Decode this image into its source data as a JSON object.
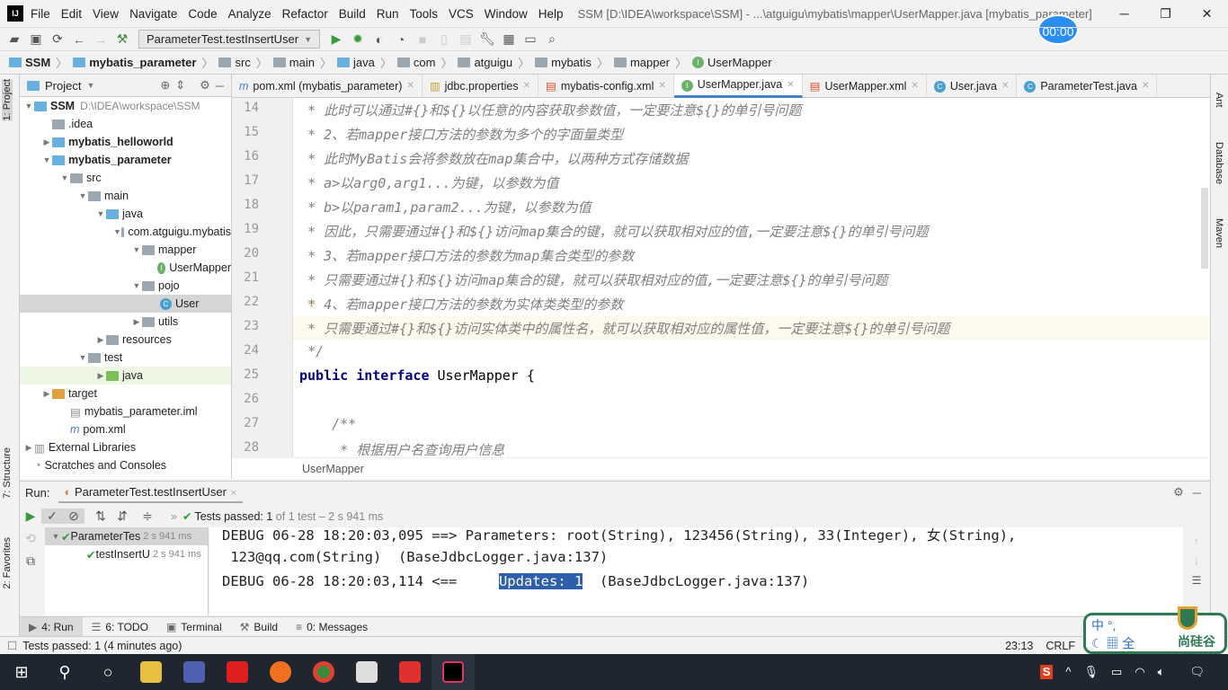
{
  "app": {
    "logo": "IJ",
    "title": "SSM [D:\\IDEA\\workspace\\SSM] - ...\\atguigu\\mybatis\\mapper\\UserMapper.java [mybatis_parameter]"
  },
  "menu": [
    "File",
    "Edit",
    "View",
    "Navigate",
    "Code",
    "Analyze",
    "Refactor",
    "Build",
    "Run",
    "Tools",
    "VCS",
    "Window",
    "Help"
  ],
  "toolbar": {
    "run_config": "ParameterTest.testInsertUser"
  },
  "breadcrumb": [
    "SSM",
    "mybatis_parameter",
    "src",
    "main",
    "java",
    "com",
    "atguigu",
    "mybatis",
    "mapper",
    "UserMapper"
  ],
  "left_stripe": {
    "project": "1: Project",
    "structure": "7: Structure",
    "favorites": "2: Favorites"
  },
  "right_stripe": {
    "ant": "Ant",
    "database": "Database",
    "maven": "Maven"
  },
  "project": {
    "header": "Project",
    "tree": [
      {
        "label": "SSM",
        "note": "D:\\IDEA\\workspace\\SSM"
      },
      {
        "label": ".idea"
      },
      {
        "label": "mybatis_helloworld"
      },
      {
        "label": "mybatis_parameter"
      },
      {
        "label": "src"
      },
      {
        "label": "main"
      },
      {
        "label": "java"
      },
      {
        "label": "com.atguigu.mybatis"
      },
      {
        "label": "mapper"
      },
      {
        "label": "UserMapper"
      },
      {
        "label": "pojo"
      },
      {
        "label": "User"
      },
      {
        "label": "utils"
      },
      {
        "label": "resources"
      },
      {
        "label": "test"
      },
      {
        "label": "java"
      },
      {
        "label": "target"
      },
      {
        "label": "mybatis_parameter.iml"
      },
      {
        "label": "pom.xml"
      },
      {
        "label": "External Libraries"
      },
      {
        "label": "Scratches and Consoles"
      }
    ]
  },
  "tabs": [
    {
      "label": "pom.xml (mybatis_parameter)",
      "icon": "m"
    },
    {
      "label": "jdbc.properties",
      "icon": "props"
    },
    {
      "label": "mybatis-config.xml",
      "icon": "xml"
    },
    {
      "label": "UserMapper.java",
      "icon": "I",
      "active": true
    },
    {
      "label": "UserMapper.xml",
      "icon": "xml"
    },
    {
      "label": "User.java",
      "icon": "C"
    },
    {
      "label": "ParameterTest.java",
      "icon": "C"
    }
  ],
  "editor": {
    "lines": [
      {
        "n": "14",
        "text": " * 此时可以通过#{}和${}以任意的内容获取参数值，一定要注意${}的单引号问题"
      },
      {
        "n": "15",
        "text": " * 2、若mapper接口方法的参数为多个的字面量类型"
      },
      {
        "n": "16",
        "text": " * 此时MyBatis会将参数放在map集合中，以两种方式存储数据"
      },
      {
        "n": "17",
        "text": " * a>以arg0,arg1...为键，以参数为值"
      },
      {
        "n": "18",
        "text": " * b>以param1,param2...为键，以参数为值"
      },
      {
        "n": "19",
        "text": " * 因此，只需要通过#{}和${}访问map集合的键，就可以获取相对应的值,一定要注意${}的单引号问题"
      },
      {
        "n": "20",
        "text": " * 3、若mapper接口方法的参数为map集合类型的参数"
      },
      {
        "n": "21",
        "text": " * 只需要通过#{}和${}访问map集合的键，就可以获取相对应的值,一定要注意${}的单引号问题"
      },
      {
        "n": "22",
        "text": " * 4、若mapper接口方法的参数为实体类类型的参数"
      },
      {
        "n": "23",
        "text": " * 只需要通过#{}和${}访问实体类中的属性名，就可以获取相对应的属性值，一定要注意${}的单引号问题"
      },
      {
        "n": "24",
        "text": " */"
      },
      {
        "n": "25",
        "kw1": "public",
        "kw2": "interface",
        "text": "UserMapper {"
      },
      {
        "n": "26",
        "text": ""
      },
      {
        "n": "27",
        "text": "    /**"
      },
      {
        "n": "28",
        "text": "     * 根据用户名查询用户信息"
      }
    ],
    "footer_crumb": "UserMapper"
  },
  "run": {
    "label": "Run:",
    "tab": "ParameterTest.testInsertUser",
    "status": "Tests passed:",
    "passed": "1",
    "of": "of 1 test – 2 s 941 ms",
    "tree": [
      {
        "label": "ParameterTes",
        "time": "2 s 941 ms"
      },
      {
        "label": "testInsertU",
        "time": "2 s 941 ms"
      }
    ],
    "console": [
      "DEBUG 06-28 18:20:03,095 ==> Parameters: root(String), 123456(String), 33(Integer), 女(String),",
      " 123@qq.com(String)  (BaseJdbcLogger.java:137)",
      "DEBUG 06-28 18:20:03,114 <==     ",
      "Updates: 1",
      "  (BaseJdbcLogger.java:137)"
    ]
  },
  "toolwindows": [
    "4: Run",
    "6: TODO",
    "Terminal",
    "Build",
    "0: Messages"
  ],
  "statusbar": {
    "message": "Tests passed: 1 (4 minutes ago)",
    "position": "23:13",
    "line_sep": "CRLF"
  },
  "overlay": {
    "timer": "00:00",
    "ime_line1": "中 °,",
    "ime_line2": "全",
    "brand": "尚硅谷"
  },
  "colors": {
    "accent": "#4083c9",
    "selection": "#2f5eaa",
    "taskbar": "#1f2630"
  }
}
